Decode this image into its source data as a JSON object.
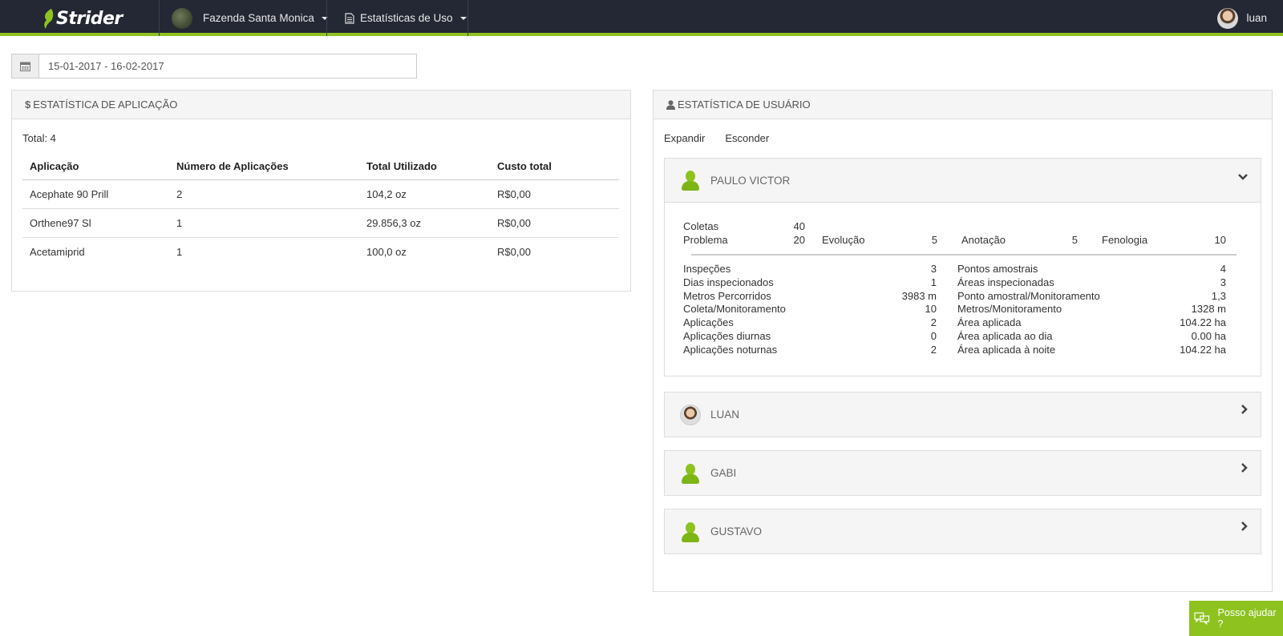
{
  "brand": {
    "name": "Strider"
  },
  "nav": {
    "farm": "Fazenda Santa Monica",
    "page": "Estatísticas de Uso",
    "user": "luan"
  },
  "date_range": {
    "value": "15-01-2017 - 16-02-2017"
  },
  "app_panel": {
    "title": "ESTATÍSTICA DE APLICAÇÃO",
    "total": "Total: 4",
    "columns": [
      "Aplicação",
      "Número de Aplicações",
      "Total Utilizado",
      "Custo total"
    ],
    "rows": [
      [
        "Acephate 90 Prill",
        "2",
        "104,2 oz",
        "R$0,00"
      ],
      [
        "Orthene97 Sl",
        "1",
        "29.856,3 oz",
        "R$0,00"
      ],
      [
        "Acetamiprid",
        "1",
        "100,0 oz",
        "R$0,00"
      ]
    ]
  },
  "user_panel": {
    "title": "ESTATÍSTICA DE USUÁRIO",
    "expand": "Expandir",
    "hide": "Esconder",
    "users": [
      {
        "name": "PAULO VICTOR",
        "avatar": "default-user-icon",
        "open": true
      },
      {
        "name": "LUAN",
        "avatar": "photo",
        "open": false
      },
      {
        "name": "GABI",
        "avatar": "default-user-icon",
        "open": false
      },
      {
        "name": "GUSTAVO",
        "avatar": "default-user-icon",
        "open": false
      }
    ],
    "detail": {
      "coletas_label": "Coletas",
      "coletas": "40",
      "problema_label": "Problema",
      "problema": "20",
      "evolucao_label": "Evolução",
      "evolucao": "5",
      "anotacao_label": "Anotação",
      "anotacao": "5",
      "fenologia_label": "Fenologia",
      "fenologia": "10",
      "left": [
        [
          "Inspeções",
          "3"
        ],
        [
          "Dias inspecionados",
          "1"
        ],
        [
          "Metros Percorridos",
          "3983 m"
        ],
        [
          "Coleta/Monitoramento",
          "10"
        ],
        [
          "Aplicações",
          "2"
        ],
        [
          "Aplicações diurnas",
          "0"
        ],
        [
          "Aplicações noturnas",
          "2"
        ]
      ],
      "right": [
        [
          "Pontos amostrais",
          "4"
        ],
        [
          "Áreas inspecionadas",
          "3"
        ],
        [
          "Ponto amostral/Monitoramento",
          "1,3"
        ],
        [
          "Metros/Monitoramento",
          "1328 m"
        ],
        [
          "Área aplicada",
          "104.22 ha"
        ],
        [
          "Área aplicada ao dia",
          "0.00 ha"
        ],
        [
          "Área aplicada à noite",
          "104.22 ha"
        ]
      ]
    }
  },
  "help": {
    "label": "Posso ajudar ?"
  },
  "colors": {
    "brand_green": "#8dc21f",
    "topbar": "#242734"
  }
}
